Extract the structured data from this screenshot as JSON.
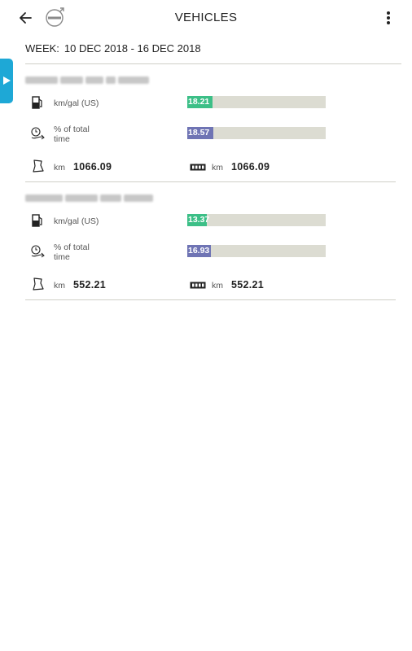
{
  "header": {
    "title": "VEHICLES"
  },
  "week": {
    "label": "WEEK:",
    "range": "10 DEC 2018 - 16 DEC 2018"
  },
  "vehicles": [
    {
      "fuel": {
        "label": "km/gal (US)",
        "value": "18.21",
        "fraction": 0.18
      },
      "time": {
        "label_line1": "% of total",
        "label_line2": "time",
        "value": "18.57",
        "fraction": 0.19
      },
      "distance": {
        "unit": "km",
        "value": "1066.09"
      },
      "odometer": {
        "unit": "km",
        "value": "1066.09"
      }
    },
    {
      "fuel": {
        "label": "km/gal (US)",
        "value": "13.37",
        "fraction": 0.14
      },
      "time": {
        "label_line1": "% of total",
        "label_line2": "time",
        "value": "16.93",
        "fraction": 0.17
      },
      "distance": {
        "unit": "km",
        "value": "552.21"
      },
      "odometer": {
        "unit": "km",
        "value": "552.21"
      }
    }
  ],
  "colors": {
    "accent": "#1ea8d6",
    "fuel_bar": "#3cbf87",
    "time_bar": "#6f74b4",
    "bar_track": "#dcdcd2"
  },
  "icons": [
    "back-arrow-icon",
    "brand-logo-icon",
    "more-vert-icon",
    "chevron-right-icon",
    "fuel-pump-icon",
    "clock-route-icon",
    "route-map-icon",
    "odometer-icon"
  ]
}
